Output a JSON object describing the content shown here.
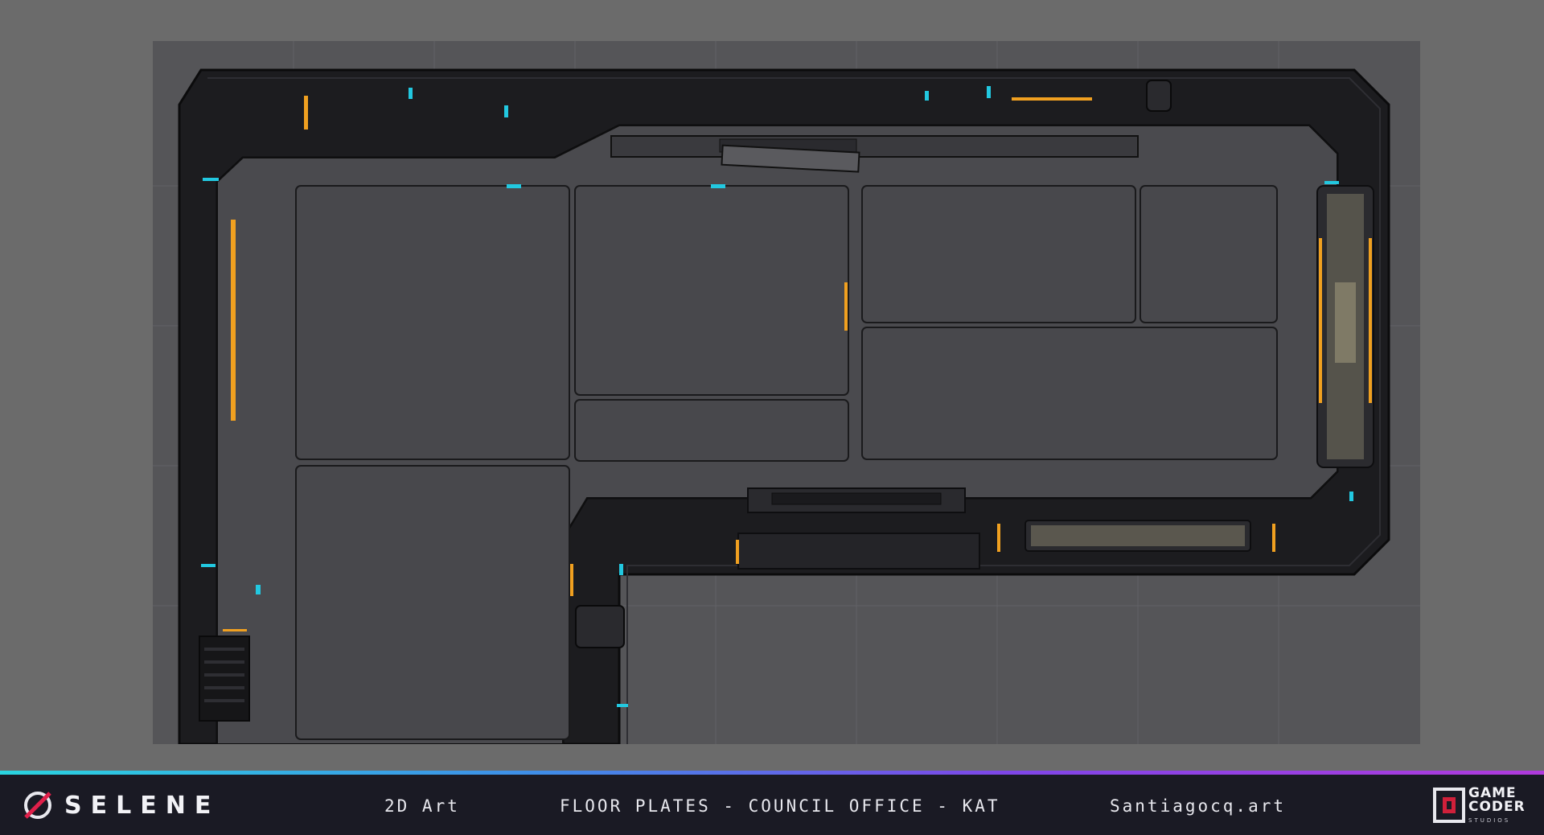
{
  "branding": {
    "game_title": "SELENE",
    "studio_name_line1": "GAME",
    "studio_name_line2": "CODER",
    "studio_sub": "STUDIOS"
  },
  "footer": {
    "category": "2D Art",
    "subject": "FLOOR PLATES - COUNCIL OFFICE - KAT",
    "website": "Santiagocq.art"
  },
  "colors": {
    "background": "#6b6b6b",
    "floor": "#4a4a4e",
    "wall_dark": "#1c1c1f",
    "wall_mid": "#2a2a2e",
    "accent_orange": "#f0a020",
    "accent_cyan": "#22c8e0",
    "footer_bg": "#1a1a24"
  },
  "icons": [
    "selene-logo-icon",
    "game-coder-logo-icon"
  ]
}
